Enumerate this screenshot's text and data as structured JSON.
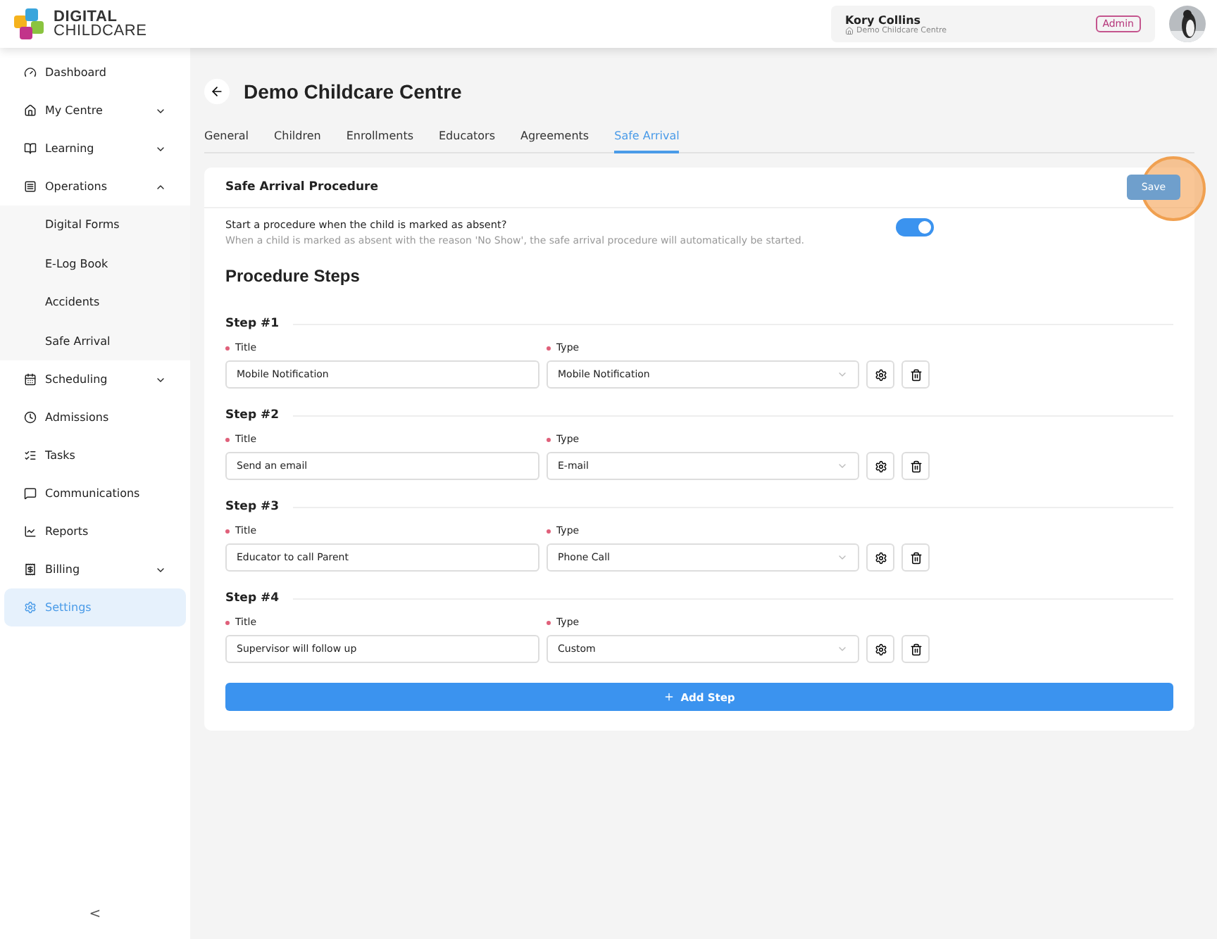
{
  "header": {
    "logo_lines": [
      "DIGITAL",
      "CHILDCARE"
    ],
    "user_name": "Kory Collins",
    "centre": "Demo Childcare Centre",
    "role": "Admin"
  },
  "sidebar": {
    "items": [
      {
        "label": "Dashboard",
        "kind": "link",
        "selected": false
      },
      {
        "label": "My Centre",
        "kind": "group",
        "expanded": false,
        "selected": false
      },
      {
        "label": "Learning",
        "kind": "group",
        "expanded": false,
        "selected": false
      },
      {
        "label": "Operations",
        "kind": "group",
        "expanded": true,
        "selected": false,
        "children": [
          {
            "label": "Digital Forms",
            "selected": false
          },
          {
            "label": "E-Log Book",
            "selected": false
          },
          {
            "label": "Accidents",
            "selected": false
          },
          {
            "label": "Safe Arrival",
            "selected": false
          }
        ]
      },
      {
        "label": "Scheduling",
        "kind": "group",
        "expanded": false,
        "selected": false
      },
      {
        "label": "Admissions",
        "kind": "link",
        "selected": false
      },
      {
        "label": "Tasks",
        "kind": "link",
        "selected": false
      },
      {
        "label": "Communications",
        "kind": "link",
        "selected": false
      },
      {
        "label": "Reports",
        "kind": "link",
        "selected": false
      },
      {
        "label": "Billing",
        "kind": "group",
        "expanded": false,
        "selected": false
      },
      {
        "label": "Settings",
        "kind": "link",
        "selected": true
      }
    ],
    "collapse": "<"
  },
  "page": {
    "title": "Demo Childcare Centre",
    "tabs": [
      {
        "label": "General",
        "selected": false
      },
      {
        "label": "Children",
        "selected": false
      },
      {
        "label": "Enrollments",
        "selected": false
      },
      {
        "label": "Educators",
        "selected": false
      },
      {
        "label": "Agreements",
        "selected": false
      },
      {
        "label": "Safe Arrival",
        "selected": true
      }
    ]
  },
  "card": {
    "title": "Safe Arrival Procedure",
    "save": {
      "label": "Save",
      "disabled": true,
      "highlighted": true
    },
    "toggle": {
      "label": "Start a procedure when the child is marked as absent?",
      "description": "When a child is marked as absent with the reason 'No Show', the safe arrival procedure will automatically be started.",
      "on": true
    },
    "section_title": "Procedure Steps",
    "steps": [
      {
        "heading": "Step #1",
        "required": true,
        "title_label": "Title",
        "title_value": "Mobile Notification",
        "type_label": "Type",
        "type_value": "Mobile Notification"
      },
      {
        "heading": "Step #2",
        "required": true,
        "title_label": "Title",
        "title_value": "Send an email",
        "type_label": "Type",
        "type_value": "E-mail"
      },
      {
        "heading": "Step #3",
        "required": true,
        "title_label": "Title",
        "title_value": "Educator to call Parent",
        "type_label": "Type",
        "type_value": "Phone Call"
      },
      {
        "heading": "Step #4",
        "required": true,
        "title_label": "Title",
        "title_value": "Supervisor will follow up",
        "type_label": "Type",
        "type_value": "Custom"
      }
    ],
    "add_button": "Add Step"
  }
}
